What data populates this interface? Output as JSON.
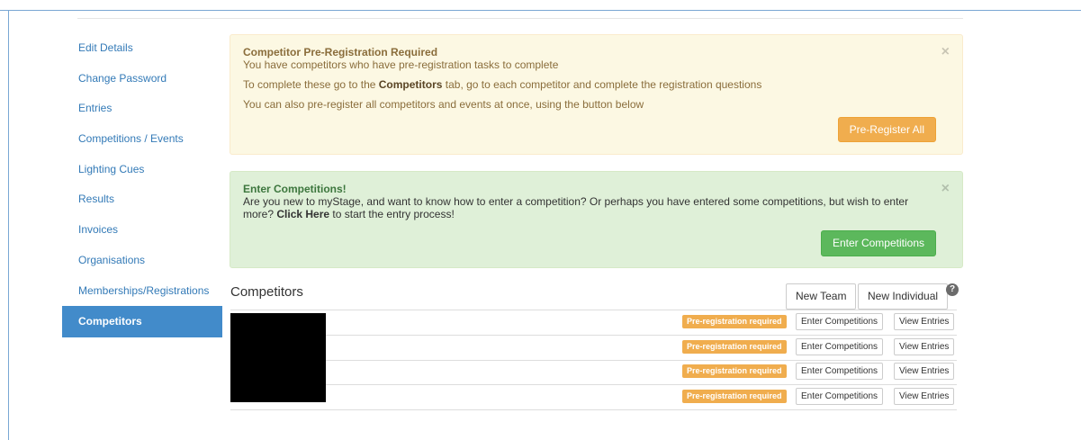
{
  "sidebar": {
    "items": [
      {
        "label": "Edit Details",
        "active": false
      },
      {
        "label": "Change Password",
        "active": false
      },
      {
        "label": "Entries",
        "active": false
      },
      {
        "label": "Competitions / Events",
        "active": false
      },
      {
        "label": "Lighting Cues",
        "active": false
      },
      {
        "label": "Results",
        "active": false
      },
      {
        "label": "Invoices",
        "active": false
      },
      {
        "label": "Organisations",
        "active": false
      },
      {
        "label": "Memberships/Registrations",
        "active": false
      },
      {
        "label": "Competitors",
        "active": true
      }
    ]
  },
  "prereg_alert": {
    "title": "Competitor Pre-Registration Required",
    "line1": "You have competitors who have pre-registration tasks to complete",
    "line2_pre": "To complete these go to the ",
    "line2_bold": "Competitors",
    "line2_post": " tab, go to each competitor and complete the registration questions",
    "line3": "You can also pre-register all competitors and events at once, using the button below",
    "button": "Pre-Register All",
    "close": "×"
  },
  "enter_alert": {
    "title": "Enter Competitions!",
    "line1": "Are you new to myStage, and want to know how to enter a competition? Or perhaps you have entered some competitions, but wish to enter",
    "line2_pre": "more? ",
    "line2_bold": "Click Here",
    "line2_post": " to start the entry process!",
    "button": "Enter Competitions",
    "close": "×"
  },
  "competitors": {
    "heading": "Competitors",
    "new_team": "New Team",
    "new_individual": "New Individual",
    "help": "?",
    "rows": [
      {
        "badge": "Pre-registration required",
        "enter": "Enter Competitions",
        "view": "View Entries"
      },
      {
        "badge": "Pre-registration required",
        "enter": "Enter Competitions",
        "view": "View Entries"
      },
      {
        "badge": "Pre-registration required",
        "enter": "Enter Competitions",
        "view": "View Entries"
      },
      {
        "badge": "Pre-registration required",
        "enter": "Enter Competitions",
        "view": "View Entries"
      }
    ]
  },
  "colors": {
    "link": "#337ab7",
    "active_nav": "#428bca",
    "warning_bg": "#fcf8e3",
    "success_bg": "#dff0d8",
    "orange": "#f0ad4e",
    "green": "#5cb85c"
  }
}
